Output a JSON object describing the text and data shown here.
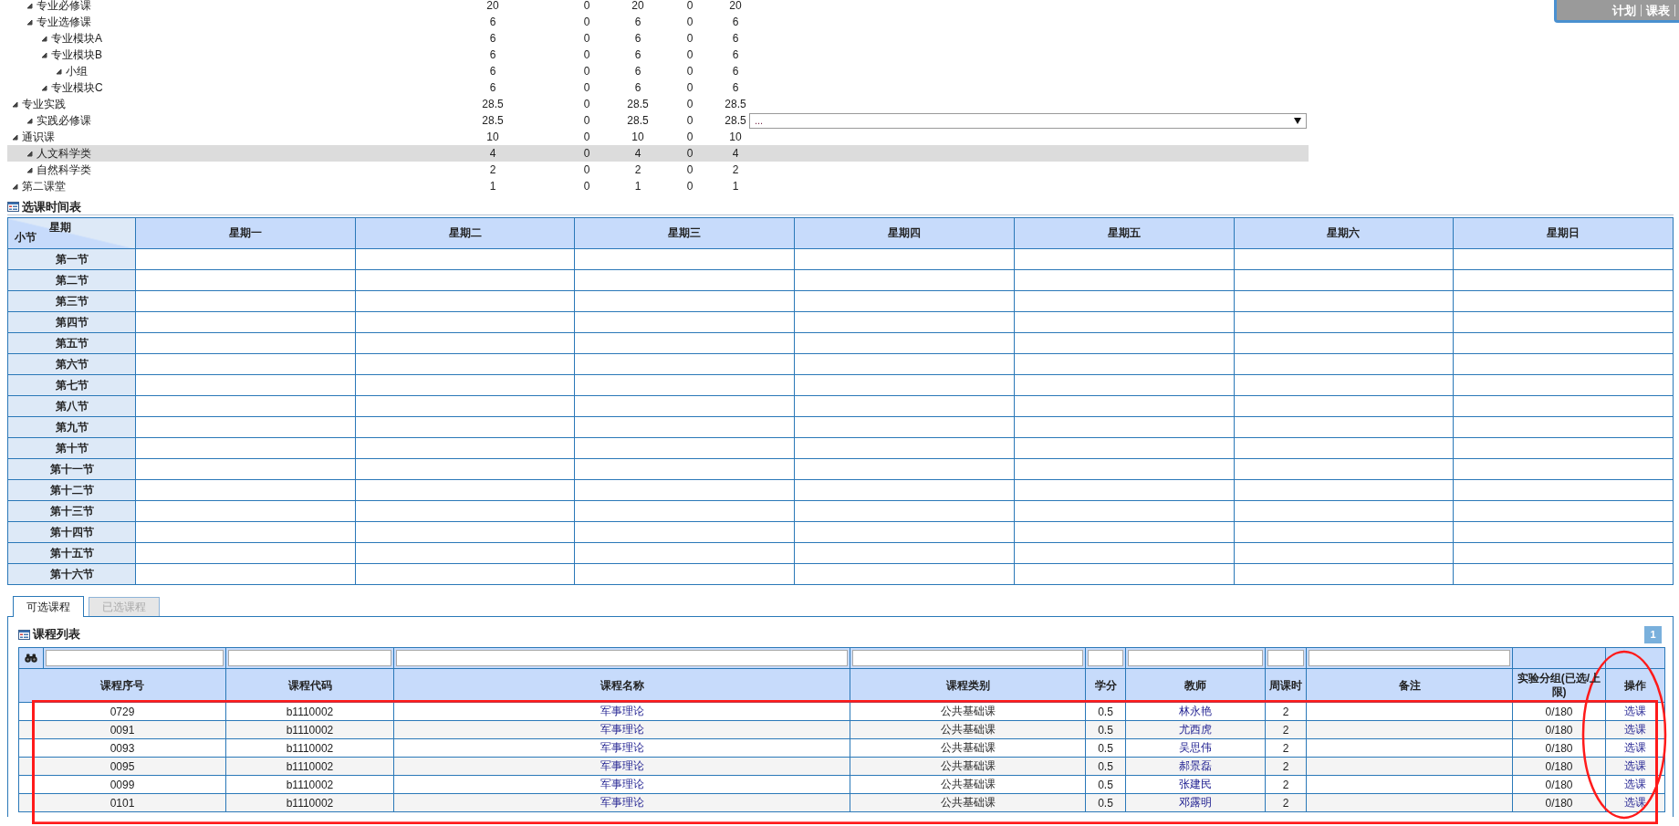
{
  "top_links": [
    {
      "label": "计划"
    },
    {
      "label": "课表"
    }
  ],
  "plan_tree": {
    "rows": [
      {
        "children": [
          {
            "label": "专业必修课",
            "expanded": true,
            "selected": false,
            "values": [
              "20",
              "0",
              "20",
              "0",
              "20"
            ]
          },
          {
            "label": "专业选修课",
            "expanded": true,
            "selected": false,
            "values": [
              "6",
              "0",
              "6",
              "0",
              "6"
            ],
            "children": [
              {
                "label": "专业模块A",
                "expanded": true,
                "selected": false,
                "values": [
                  "6",
                  "0",
                  "6",
                  "0",
                  "6"
                ]
              },
              {
                "label": "专业模块B",
                "expanded": true,
                "selected": false,
                "values": [
                  "6",
                  "0",
                  "6",
                  "0",
                  "6"
                ],
                "children": [
                  {
                    "label": "小组",
                    "expanded": true,
                    "selected": false,
                    "values": [
                      "6",
                      "0",
                      "6",
                      "0",
                      "6"
                    ]
                  }
                ]
              },
              {
                "label": "专业模块C",
                "expanded": true,
                "selected": false,
                "values": [
                  "6",
                  "0",
                  "6",
                  "0",
                  "6"
                ]
              }
            ]
          }
        ]
      },
      {
        "label": "专业实践",
        "expanded": true,
        "selected": false,
        "values": [
          "28.5",
          "0",
          "28.5",
          "0",
          "28.5"
        ],
        "children": [
          {
            "label": "实践必修课",
            "expanded": true,
            "selected": false,
            "values": [
              "28.5",
              "0",
              "28.5",
              "0",
              "28.5"
            ],
            "select": {
              "value": "..."
            }
          }
        ]
      },
      {
        "label": "通识课",
        "expanded": true,
        "selected": false,
        "values": [
          "10",
          "0",
          "10",
          "0",
          "10"
        ],
        "children": [
          {
            "label": "人文科学类",
            "expanded": true,
            "selected": true,
            "values": [
              "4",
              "0",
              "4",
              "0",
              "4"
            ]
          },
          {
            "label": "自然科学类",
            "expanded": true,
            "selected": false,
            "values": [
              "2",
              "0",
              "2",
              "0",
              "2"
            ]
          }
        ]
      },
      {
        "label": "第二课堂",
        "expanded": true,
        "selected": false,
        "values": [
          "1",
          "0",
          "1",
          "0",
          "1"
        ]
      }
    ]
  },
  "schedule": {
    "title": "选课时间表",
    "corner_top": "星期",
    "corner_bottom": "小节",
    "days": [
      "星期一",
      "星期二",
      "星期三",
      "星期四",
      "星期五",
      "星期六",
      "星期日"
    ],
    "periods": [
      "第一节",
      "第二节",
      "第三节",
      "第四节",
      "第五节",
      "第六节",
      "第七节",
      "第八节",
      "第九节",
      "第十节",
      "第十一节",
      "第十二节",
      "第十三节",
      "第十四节",
      "第十五节",
      "第十六节"
    ]
  },
  "course_tabs": [
    {
      "label": "可选课程",
      "selected": true
    },
    {
      "label": "已选课程",
      "selected": false
    }
  ],
  "course_list": {
    "title": "课程列表",
    "pages": [
      {
        "label": "1",
        "selected": true
      }
    ],
    "columns": [
      {
        "label": "课程序号",
        "kind": "text",
        "filter": true
      },
      {
        "label": "课程代码",
        "kind": "text",
        "filter": true
      },
      {
        "label": "课程名称",
        "kind": "link",
        "filter": true
      },
      {
        "label": "课程类别",
        "kind": "text",
        "filter": true
      },
      {
        "label": "学分",
        "kind": "text",
        "filter": true
      },
      {
        "label": "教师",
        "kind": "link",
        "filter": true
      },
      {
        "label": "周课时",
        "kind": "text",
        "filter": true
      },
      {
        "label": "备注",
        "kind": "text",
        "filter": true
      },
      {
        "label": "实验分组(已选/上限)",
        "kind": "text",
        "filter": false
      },
      {
        "label": "操作",
        "kind": "link",
        "filter": false
      }
    ],
    "rows": [
      {
        "cells": [
          "0729",
          "b1110002",
          "军事理论",
          "公共基础课",
          "0.5",
          "林永艳",
          "2",
          "",
          "0/180",
          "选课"
        ]
      },
      {
        "cells": [
          "0091",
          "b1110002",
          "军事理论",
          "公共基础课",
          "0.5",
          "尤西虎",
          "2",
          "",
          "0/180",
          "选课"
        ]
      },
      {
        "cells": [
          "0093",
          "b1110002",
          "军事理论",
          "公共基础课",
          "0.5",
          "吴思伟",
          "2",
          "",
          "0/180",
          "选课"
        ]
      },
      {
        "cells": [
          "0095",
          "b1110002",
          "军事理论",
          "公共基础课",
          "0.5",
          "郝景磊",
          "2",
          "",
          "0/180",
          "选课"
        ]
      },
      {
        "cells": [
          "0099",
          "b1110002",
          "军事理论",
          "公共基础课",
          "0.5",
          "张建民",
          "2",
          "",
          "0/180",
          "选课"
        ]
      },
      {
        "cells": [
          "0101",
          "b1110002",
          "军事理论",
          "公共基础课",
          "0.5",
          "邓露明",
          "2",
          "",
          "0/180",
          "选课"
        ]
      }
    ]
  },
  "annotations": [
    {
      "kind": "rectangle"
    },
    {
      "kind": "ellipse"
    }
  ]
}
